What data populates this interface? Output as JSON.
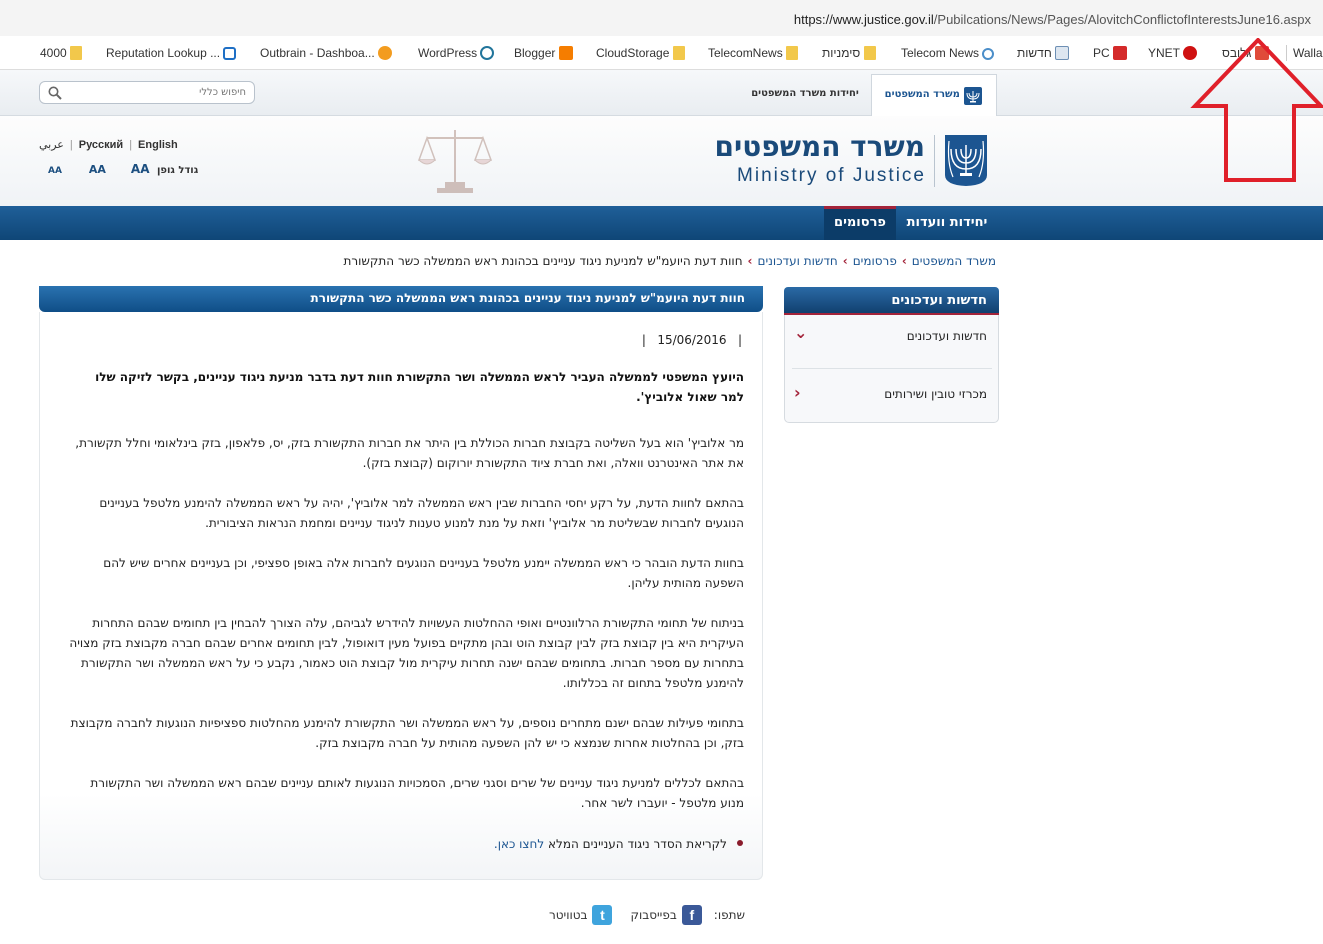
{
  "browser": {
    "url_host": "https://www.justice.gov.il",
    "url_path": "/Pubilcations/News/Pages/AlovitchConflictofInterestsJune16.aspx",
    "bookmarks": [
      {
        "label": "4000",
        "icon": "folder-icon"
      },
      {
        "label": "Reputation Lookup ...",
        "icon": "reputation-icon"
      },
      {
        "label": "Outbrain - Dashboa...",
        "icon": "outbrain-icon"
      },
      {
        "label": "WordPress",
        "icon": "wordpress-icon"
      },
      {
        "label": "Blogger",
        "icon": "blogger-icon"
      },
      {
        "label": "CloudStorage",
        "icon": "folder-icon"
      },
      {
        "label": "TelecomNews",
        "icon": "folder-icon"
      },
      {
        "label": "סימניות",
        "icon": "folder-icon"
      },
      {
        "label": "Telecom News",
        "icon": "telecom-icon"
      },
      {
        "label": "חדשות",
        "icon": "news-icon"
      },
      {
        "label": "PC",
        "icon": "pc-icon"
      },
      {
        "label": "YNET",
        "icon": "ynet-icon"
      },
      {
        "label": "גלובס",
        "icon": "globes-icon"
      },
      {
        "label": "Walla",
        "icon": "walla-icon"
      }
    ]
  },
  "site": {
    "search_placeholder": "חיפוש כללי",
    "tab_ministry": "משרד המשפטים",
    "tab_units": "יחידות משרד המשפטים",
    "lang_english": "English",
    "lang_russian": "Русский",
    "lang_arabic": "عربي",
    "font_size_label": "גודל גופן",
    "font_a_large": "AA",
    "font_a_medium": "AA",
    "font_a_small": "AA",
    "logo_hebrew": "משרד המשפטים",
    "logo_english": "Ministry of Justice",
    "nav_units": "יחידות וועדות",
    "nav_publications": "פרסומים"
  },
  "breadcrumb": {
    "items": [
      "משרד המשפטים",
      "פרסומים",
      "חדשות ועדכונים"
    ],
    "current": "חוות דעת היועמ\"ש למניעת ניגוד עניינים בכהונת ראש הממשלה כשר התקשורת"
  },
  "article": {
    "title": "חוות דעת היועמ\"ש למניעת ניגוד עניינים בכהונת ראש הממשלה כשר התקשורת",
    "date": "15/06/2016",
    "lead": "היועץ המשפטי לממשלה העביר לראש הממשלה ושר התקשורת חוות דעת בדבר מניעת ניגוד עניינים, בקשר לזיקה שלו למר שאול אלוביץ'.",
    "paragraphs": [
      "מר אלוביץ' הוא בעל השליטה בקבוצת חברות הכוללת בין היתר את חברות התקשורת בזק, יס, פלאפון, בזק בינלאומי וחלל תקשורת, את אתר האינטרנט וואלה, ואת חברת ציוד התקשורת יורוקום (קבוצת בזק).",
      "בהתאם לחוות הדעת, על רקע יחסי החברות שבין ראש הממשלה למר אלוביץ', יהיה על ראש הממשלה להימנע מלטפל בעניינים הנוגעים לחברות שבשליטת מר אלוביץ' וזאת על מנת למנוע טענות לניגוד עניינים ומחמת הנראות הציבורית.",
      "בחוות הדעת הובהר כי ראש הממשלה יימנע מלטפל בעניינים הנוגעים לחברות אלה באופן ספציפי, וכן בעניינים אחרים שיש להם השפעה מהותית עליהן.",
      "בניתוח של תחומי התקשורת הרלוונטיים ואופי ההחלטות העשויות להידרש לגביהם, עלה הצורך להבחין בין תחומים שבהם התחרות העיקרית היא בין קבוצת בזק לבין קבוצת הוט ובהן מתקיים בפועל מעין דואופול, לבין תחומים אחרים שבהם חברה מקבוצת בזק מצויה בתחרות עם מספר חברות. בתחומים שבהם ישנה תחרות עיקרית מול קבוצת הוט כאמור, נקבע כי על ראש הממשלה ושר התקשורת להימנע מלטפל בתחום זה בכללותו.",
      "בתחומי פעילות שבהם ישנם מתחרים נוספים, על ראש הממשלה ושר התקשורת להימנע מהחלטות ספציפיות הנוגעות לחברה מקבוצת בזק, וכן בהחלטות אחרות שנמצא כי יש להן השפעה מהותית על חברה מקבוצת בזק.",
      "בהתאם לכללים למניעת ניגוד עניינים של שרים וסגני שרים, הסמכויות הנוגעות לאותם עניינים שבהם ראש הממשלה ושר התקשורת מנוע מלטפל - יועברו לשר אחר."
    ],
    "readmore_text": "לקריאת הסדר ניגוד העניינים המלא ",
    "readmore_link": "לחצו כאן."
  },
  "share": {
    "label": "שתפו:",
    "facebook": "בפייסבוק",
    "twitter": "בטוויטר"
  },
  "sidebar": {
    "title": "חדשות ועדכונים",
    "items": [
      {
        "label": "חדשות ועדכונים",
        "chevron": "⌄"
      },
      {
        "label": "מכרזי טובין ושירותים",
        "chevron": "‹"
      }
    ]
  },
  "colors": {
    "nav_blue": "#0f4677",
    "accent_red": "#a3243a",
    "annotation_red": "#e0202a"
  }
}
